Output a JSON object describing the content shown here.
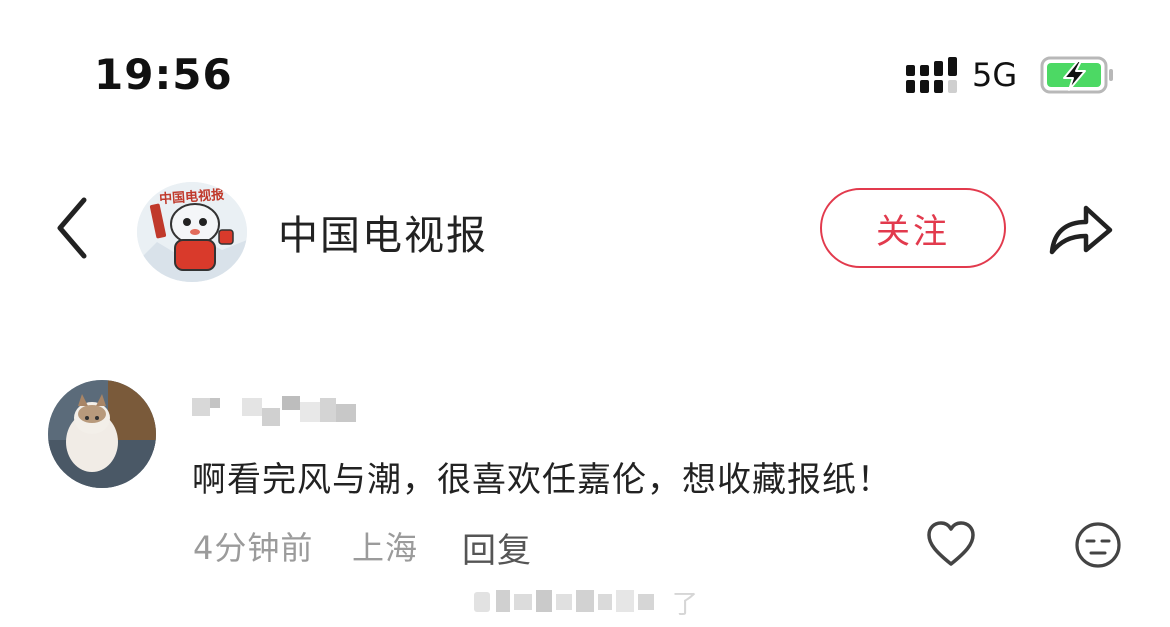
{
  "status_bar": {
    "time": "19:56",
    "network": "5G"
  },
  "header": {
    "account_name": "中国电视报",
    "follow_label": "关注",
    "avatar_text": "中国电视报"
  },
  "comment": {
    "text": "啊看完风与潮，很喜欢任嘉伦，想收藏报纸！",
    "time_ago": "4分钟前",
    "location": "上海",
    "reply_label": "回复",
    "obscured_tail": "了"
  },
  "colors": {
    "accent": "#e23a4d",
    "battery": "#4cd964",
    "meta": "#9b9b9b"
  },
  "icons": [
    "back-chevron-icon",
    "share-icon",
    "heart-icon",
    "face-icon",
    "signal-icon",
    "battery-charging-icon"
  ]
}
